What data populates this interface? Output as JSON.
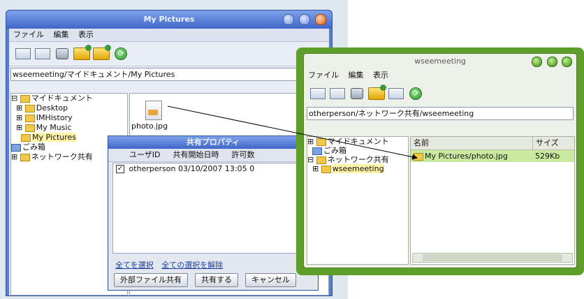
{
  "left_window": {
    "title": "My Pictures",
    "menu": [
      "ファイル",
      "編集",
      "表示"
    ],
    "address": "wseemeeting/マイドキュメント/My Pictures",
    "tree": [
      "マイドキュメント",
      "Desktop",
      "IMHistory",
      "My Music",
      "My Pictures",
      "ごみ箱",
      "ネットワーク共有"
    ],
    "file": "photo.jpg"
  },
  "dialog": {
    "title": "共有プロパティ",
    "columns": [
      "ユーザID",
      "共有開始日時",
      "許可数"
    ],
    "row": {
      "user": "otherperson",
      "date": "03/10/2007 13:05",
      "count": "0"
    },
    "links": [
      "全てを選択",
      "全ての選択を解除"
    ],
    "buttons": [
      "外部ファイル共有",
      "共有する",
      "キャンセル"
    ]
  },
  "right_window": {
    "title": "wseemeeting",
    "menu": [
      "ファイル",
      "編集",
      "表示"
    ],
    "address": "otherperson/ネットワーク共有/wseemeeting",
    "tree": [
      "マイドキュメント",
      "ごみ箱",
      "ネットワーク共有",
      "wseemeeting"
    ],
    "columns": [
      "名前",
      "サイズ"
    ],
    "row": {
      "name": "My Pictures/photo.jpg",
      "size": "529Kb"
    }
  },
  "colors": {
    "left_frame": "#5b7fcf",
    "right_frame": "#5f9e2a",
    "selected_row": "#c9e99f"
  }
}
